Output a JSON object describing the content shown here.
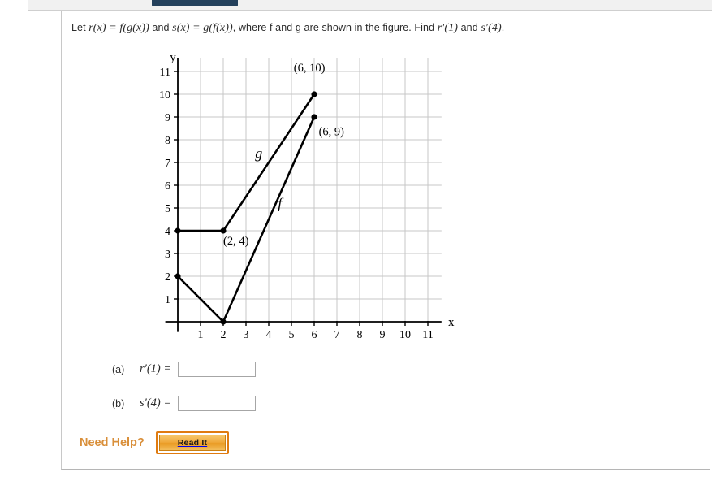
{
  "problem": {
    "prefix": "Let ",
    "r_def": "r(x) = f(g(x))",
    "and1": " and ",
    "s_def": "s(x) = g(f(x))",
    "middle": ", where f and g are shown in the figure. Find ",
    "find1": "r′(1)",
    "and2": " and ",
    "find2": "s′(4)",
    "period": ".",
    "full_text": "Let r(x) = f(g(x)) and s(x) = g(f(x)), where f and g are shown in the figure. Find r′(1) and s′(4)."
  },
  "chart_data": {
    "type": "line",
    "title": "",
    "xlabel": "x",
    "ylabel": "y",
    "xlim": [
      0,
      11.6
    ],
    "ylim": [
      0,
      11.6
    ],
    "grid": true,
    "xticks": [
      1,
      2,
      3,
      4,
      5,
      6,
      7,
      8,
      9,
      10,
      11
    ],
    "yticks": [
      1,
      2,
      3,
      4,
      5,
      6,
      7,
      8,
      9,
      10,
      11
    ],
    "legend_position": "inline-curve-labels",
    "series": [
      {
        "name": "g",
        "label": "g",
        "label_at": [
          3.4,
          7.2
        ],
        "points": [
          [
            0,
            4
          ],
          [
            2,
            4
          ],
          [
            6,
            10
          ]
        ],
        "markers": [
          [
            0,
            4
          ],
          [
            2,
            4
          ],
          [
            6,
            10
          ]
        ],
        "color": "#000000"
      },
      {
        "name": "f",
        "label": "f",
        "label_at": [
          4.4,
          5.0
        ],
        "points": [
          [
            0,
            2
          ],
          [
            2,
            0
          ],
          [
            6,
            9
          ]
        ],
        "markers": [
          [
            0,
            2
          ],
          [
            2,
            0
          ],
          [
            6,
            9
          ]
        ],
        "color": "#000000"
      }
    ],
    "annotations": [
      {
        "text": "(6, 10)",
        "at": [
          5.1,
          11.0
        ]
      },
      {
        "text": "(6, 9)",
        "at": [
          6.2,
          8.2
        ]
      },
      {
        "text": "(2, 4)",
        "at": [
          2.0,
          3.4
        ]
      }
    ]
  },
  "answers": [
    {
      "letter": "(a)",
      "expression": "r′(1) =",
      "value": "",
      "placeholder": ""
    },
    {
      "letter": "(b)",
      "expression": "s′(4) =",
      "value": "",
      "placeholder": ""
    }
  ],
  "help": {
    "label": "Need Help?",
    "button_label": "Read It"
  },
  "colors": {
    "help_label": "#d98f3a",
    "button_border": "#e07b10",
    "button_fill": "#f0a93c",
    "curve": "#000000",
    "grid": "#c7c7c7",
    "top_tab": "#24415c"
  }
}
